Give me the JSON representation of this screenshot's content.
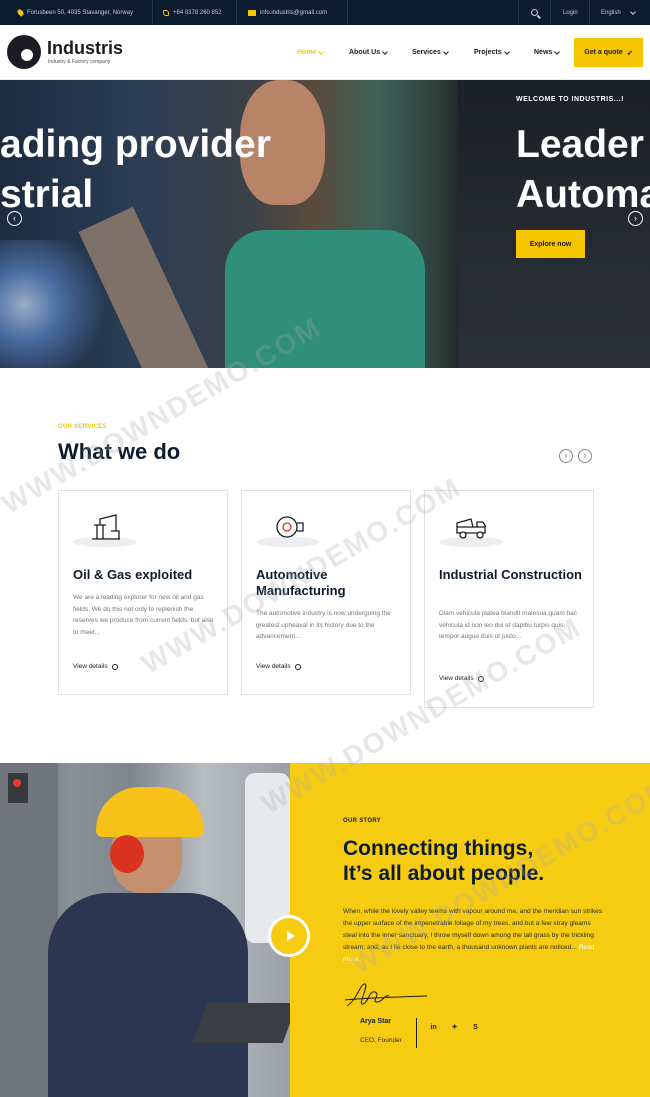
{
  "topbar": {
    "address": "Forusbeen 50, 4035 Stavanger, Norway",
    "phone": "+84 0378 260 852",
    "email": "info.industris@gmail.com",
    "login": "Login",
    "language": "English"
  },
  "brand": {
    "name": "Industris",
    "tagline": "Industry & Factory company"
  },
  "nav": {
    "items": [
      {
        "label": "Home"
      },
      {
        "label": "About Us"
      },
      {
        "label": "Services"
      },
      {
        "label": "Projects"
      },
      {
        "label": "News"
      }
    ],
    "quote_label": "Get a quote"
  },
  "hero": {
    "slide_left_line1": "ading provider",
    "slide_left_line2": "strial",
    "welcome": "WELCOME TO INDUSTRIS...!",
    "slide_right_line1": "Leader",
    "slide_right_line2": "Automa",
    "explore_label": "Explore now"
  },
  "services": {
    "eyebrow": "OUR SERVICES",
    "title": "What we do",
    "cards": [
      {
        "title": "Oil & Gas exploited",
        "desc": "We are a leading explorer for new oil and gas fields. We do this not only to replenish the reserves we produce from current fields, but also to meet...",
        "link": "View details",
        "icon": "oil-pump-icon"
      },
      {
        "title": "Automotive Manufacturing",
        "desc": "The automotive industry is now undergoing the greatest upheaval in its history due to the advancement...",
        "link": "View details",
        "icon": "turbine-icon"
      },
      {
        "title": "Industrial Construction",
        "desc": "Diam vehicula platea blandit malesua quam hac vehicula id non leo dui et dapibu turpis quis, tempor augue duis ut justo...",
        "link": "View details",
        "icon": "dump-truck-icon"
      }
    ]
  },
  "story": {
    "eyebrow": "OUR STORY",
    "title_line1": "Connecting things,",
    "title_line2": "It’s all about people.",
    "text": "When, while the lovely valley teems with vapour around me, and the meridian sun strikes the upper surface of the impenetrable foliage of my trees, and but a few stray gleams steal into the inner sanctuary, I throw myself down among the tall grass by the trickling stream; and, as I lie close to the earth, a thousand unknown plants are noticed...",
    "read_more": "Read more",
    "name": "Arya Star",
    "role": "CEO, Founder",
    "social": [
      "LinkedIn",
      "Twitter",
      "Skype"
    ]
  },
  "watermark": "WWW.DOWNDEMO.COM",
  "colors": {
    "accent": "#f5c500",
    "dark": "#0d1b2e",
    "topbar": "#0d1b2e"
  }
}
